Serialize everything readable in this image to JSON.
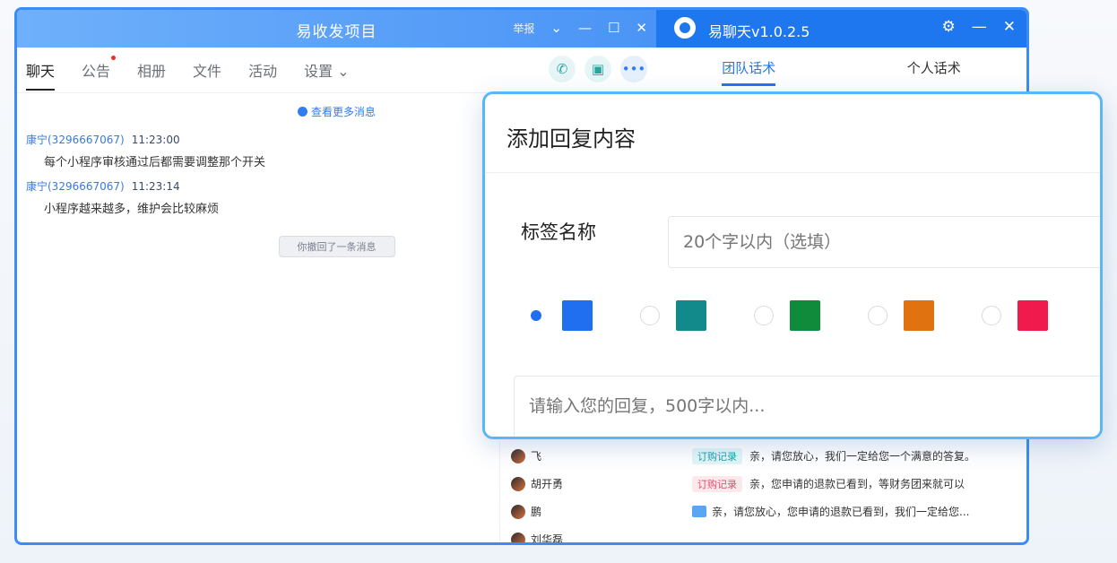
{
  "chat_window": {
    "title": "易收发项目",
    "controls": {
      "label": "举报",
      "chevron": "chevron-down-icon",
      "minimize": "minimize-icon",
      "maximize": "maximize-icon",
      "close": "close-icon"
    },
    "tabs": [
      {
        "label": "聊天",
        "active": true
      },
      {
        "label": "公告",
        "has_dot": true
      },
      {
        "label": "相册"
      },
      {
        "label": "文件"
      },
      {
        "label": "活动"
      },
      {
        "label": "设置 ⌄"
      }
    ],
    "tools": [
      "phone-icon",
      "screen-share-icon",
      "more-icon"
    ],
    "load_more": "查看更多消息",
    "messages": [
      {
        "sender": "康宁(3296667067)",
        "time": "11:23:00",
        "text": "每个小程序审核通过后都需要调整那个开关"
      },
      {
        "sender": "康宁(3296667067)",
        "time": "11:23:14",
        "text": "小程序越来越多，维护会比较麻烦"
      }
    ],
    "recall_notice": "你撤回了一条消息",
    "contacts": [
      {
        "name": "飞"
      },
      {
        "name": "胡开勇"
      },
      {
        "name": "鹏"
      },
      {
        "name": "刘华磊"
      }
    ]
  },
  "side_panel": {
    "title": "易聊天v1.0.2.5",
    "tabs": [
      {
        "label": "团队话术",
        "active": true
      },
      {
        "label": "个人话术"
      }
    ],
    "rows": [
      {
        "badge": "订购记录",
        "badge_color": "teal",
        "text": "亲，请您放心，我们一定给您一个满意的答复。"
      },
      {
        "badge": "订购记录",
        "badge_color": "pink",
        "text": "亲，您申请的退款已看到，等财务团来就可以"
      },
      {
        "badge": "",
        "text": "亲，请您放心，您申请的退款已看到，我们一定给您..."
      }
    ]
  },
  "modal": {
    "title": "添加回复内容",
    "tag_label": "标签名称",
    "tag_placeholder": "20个字以内（选填）",
    "colors": [
      {
        "hex": "#1f6ff0",
        "selected": true
      },
      {
        "hex": "#128a8c",
        "selected": false
      },
      {
        "hex": "#108a3b",
        "selected": false
      },
      {
        "hex": "#e0720f",
        "selected": false
      },
      {
        "hex": "#f01a4d",
        "selected": false
      }
    ],
    "reply_placeholder": "请输入您的回复，500字以内..."
  }
}
